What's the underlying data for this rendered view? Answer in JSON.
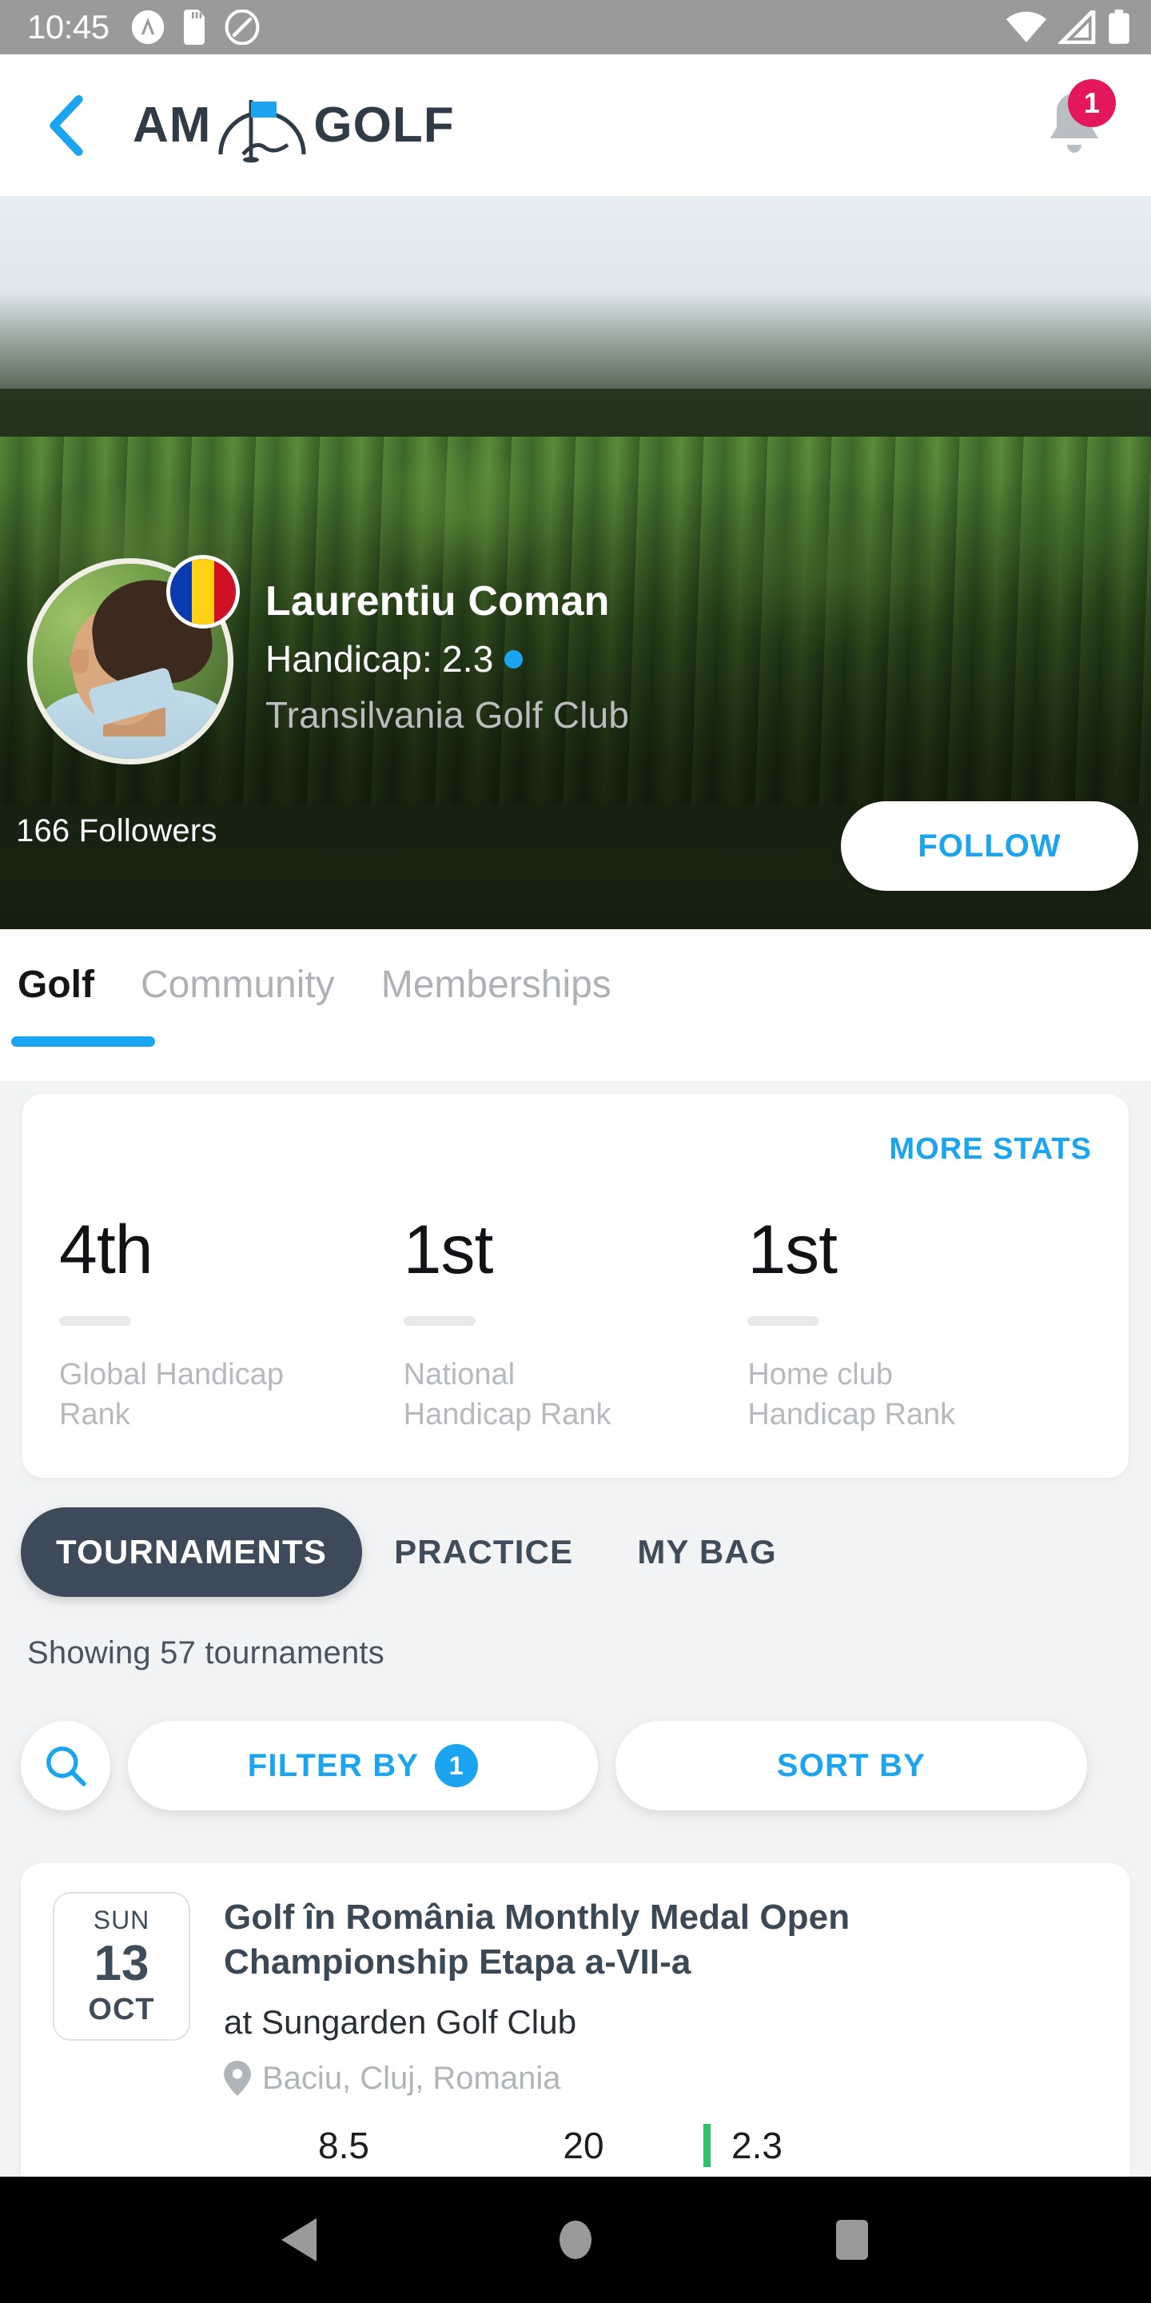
{
  "status_bar": {
    "time": "10:45",
    "left_icons": [
      "circle-a-icon",
      "sd-card-icon",
      "dnd-icon"
    ],
    "right_icons": [
      "wifi-icon",
      "cell-signal-icon",
      "battery-icon"
    ],
    "background_color": "#9a9a9a"
  },
  "app_bar": {
    "back_label": "back-chevron",
    "brand_left": "AM",
    "brand_right": "GOLF",
    "logo_icon": "golf-flag-dome-icon",
    "notification_count": "1",
    "badge_color": "#e4175c",
    "accent_color": "#1ba5f0"
  },
  "profile": {
    "name": "Laurentiu Coman",
    "handicap_label": "Handicap:",
    "handicap_value": "2.3",
    "club": "Transilvania Golf Club",
    "followers": "166 Followers",
    "follow_button": "FOLLOW",
    "country_flag": "romania-flag-icon",
    "flag_colors": [
      "#0a3bb0",
      "#fcd116",
      "#ce1126"
    ]
  },
  "tabs": [
    {
      "label": "Golf",
      "active": true
    },
    {
      "label": "Community",
      "active": false
    },
    {
      "label": "Memberships",
      "active": false
    }
  ],
  "stats_card": {
    "more_stats_label": "MORE STATS",
    "stats": [
      {
        "value": "4th",
        "label_line1": "Global Handicap",
        "label_line2": "Rank"
      },
      {
        "value": "1st",
        "label_line1": "National",
        "label_line2": "Handicap Rank"
      },
      {
        "value": "1st",
        "label_line1": "Home club",
        "label_line2": "Handicap Rank"
      }
    ]
  },
  "segments": [
    {
      "label": "TOURNAMENTS",
      "active": true
    },
    {
      "label": "PRACTICE",
      "active": false
    },
    {
      "label": "MY BAG",
      "active": false
    }
  ],
  "showing_text": "Showing 57 tournaments",
  "filter_row": {
    "search_icon": "search-icon",
    "filter_label": "FILTER BY",
    "filter_count": "1",
    "sort_label": "SORT BY"
  },
  "tournament": {
    "date_dow": "SUN",
    "date_day": "13",
    "date_month": "OCT",
    "title": "Golf în România Monthly Medal Open Championship Etapa a-VII-a",
    "venue": "at Sungarden Golf Club",
    "location": "Baciu, Cluj, Romania",
    "location_icon": "map-pin-icon",
    "stat1": "8.5",
    "stat2": "20",
    "stat3": "2.3",
    "stat3_accent": "#2fc26a"
  },
  "nav_bar": {
    "back": "nav-back-icon",
    "home": "nav-home-icon",
    "recents": "nav-recents-icon"
  }
}
